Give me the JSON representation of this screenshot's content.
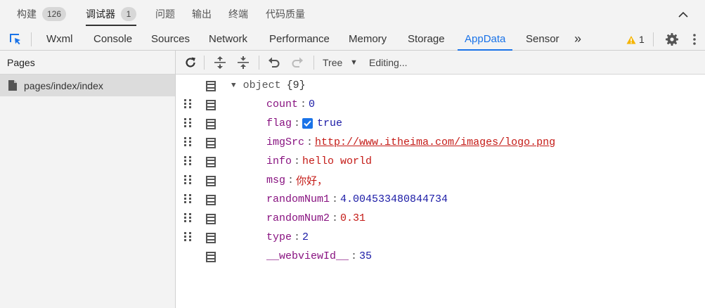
{
  "top_tabs": [
    {
      "label": "构建",
      "badge": "126"
    },
    {
      "label": "调试器",
      "badge": "1",
      "active": true
    },
    {
      "label": "问题"
    },
    {
      "label": "输出"
    },
    {
      "label": "终端"
    },
    {
      "label": "代码质量"
    }
  ],
  "panel_tabs": [
    "Wxml",
    "Console",
    "Sources",
    "Network",
    "Performance",
    "Memory",
    "Storage",
    "AppData",
    "Sensor"
  ],
  "active_panel": "AppData",
  "more_tabs_glyph": "»",
  "warnings": {
    "icon": "warning-icon",
    "count": "1"
  },
  "sidebar": {
    "title": "Pages",
    "items": [
      {
        "label": "pages/index/index",
        "icon": "file-icon"
      }
    ]
  },
  "toolbar": {
    "buttons": [
      "refresh-icon",
      "expand-all-icon",
      "collapse-all-icon",
      "undo-icon",
      "redo-icon"
    ],
    "view_mode": "Tree",
    "status": "Editing..."
  },
  "tree": {
    "root_type": "object",
    "root_count": "{9}",
    "entries": [
      {
        "key": "count",
        "value": "0",
        "kind": "number"
      },
      {
        "key": "flag",
        "value": "true",
        "kind": "boolean",
        "checked": true
      },
      {
        "key": "imgSrc",
        "value": "http://www.itheima.com/images/logo.png",
        "kind": "link"
      },
      {
        "key": "info",
        "value": "hello world",
        "kind": "string"
      },
      {
        "key": "msg",
        "value": "你好，",
        "kind": "string"
      },
      {
        "key": "randomNum1",
        "value": "4.004533480844734",
        "kind": "number"
      },
      {
        "key": "randomNum2",
        "value": "0.31",
        "kind": "string"
      },
      {
        "key": "type",
        "value": "2",
        "kind": "number"
      },
      {
        "key": "__webviewId__",
        "value": "35",
        "kind": "number"
      }
    ]
  },
  "colors": {
    "accent": "#1a73e8",
    "warning": "#f5b400",
    "key": "#881280",
    "string": "#c41a16",
    "number": "#1a1aa6"
  }
}
